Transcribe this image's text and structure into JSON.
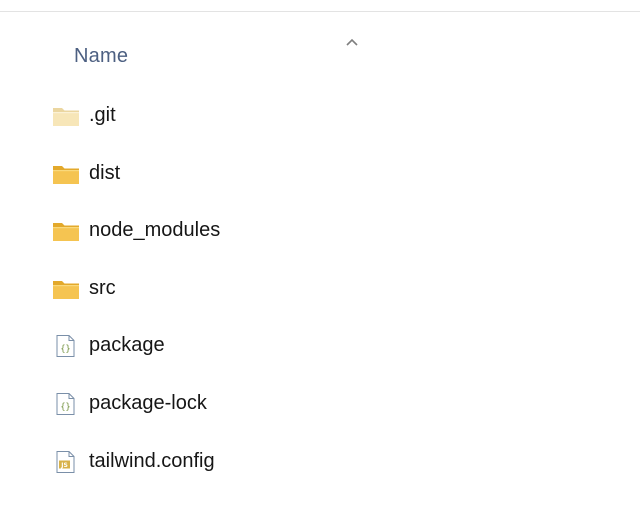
{
  "window": {
    "header": {
      "name_column_label": "Name",
      "sort_direction": "ascending"
    }
  },
  "files": [
    {
      "name": ".git",
      "type": "folder",
      "hidden": true,
      "icon": "folder-icon"
    },
    {
      "name": "dist",
      "type": "folder",
      "hidden": false,
      "icon": "folder-icon"
    },
    {
      "name": "node_modules",
      "type": "folder",
      "hidden": false,
      "icon": "folder-icon"
    },
    {
      "name": "src",
      "type": "folder",
      "hidden": false,
      "icon": "folder-icon"
    },
    {
      "name": "package",
      "type": "json",
      "hidden": false,
      "icon": "json-file-icon"
    },
    {
      "name": "package-lock",
      "type": "json",
      "hidden": false,
      "icon": "json-file-icon"
    },
    {
      "name": "tailwind.config",
      "type": "js",
      "hidden": false,
      "icon": "js-file-icon"
    }
  ],
  "colors": {
    "folder_body": "#F5C451",
    "folder_tab": "#E3A92B",
    "folder_hidden_body": "#F7E6B8",
    "folder_hidden_tab": "#EBD6A0",
    "header_text": "#4D6082",
    "file_text": "#161616",
    "doc_border": "#7A8FA8",
    "json_accent": "#6F8F3A",
    "js_badge": "#D8B24A"
  }
}
